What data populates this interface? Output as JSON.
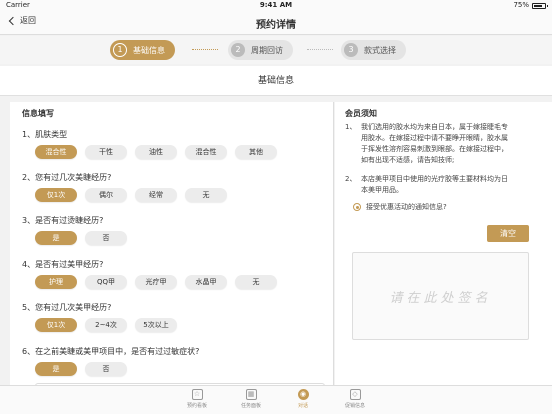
{
  "status": {
    "carrier": "Carrier",
    "time": "9:41 AM",
    "battery": "75%",
    "battery_level": 0.75
  },
  "nav": {
    "back_label": "返回",
    "title": "预约详情"
  },
  "steps": [
    {
      "num": "1",
      "label": "基础信息",
      "state": "active"
    },
    {
      "num": "2",
      "label": "周期回访",
      "state": "idle"
    },
    {
      "num": "3",
      "label": "款式选择",
      "state": "idle"
    }
  ],
  "section_title": "基础信息",
  "form": {
    "heading": "信息填写",
    "questions": [
      {
        "text": "1、肌肤类型",
        "options": [
          "混合性",
          "干性",
          "油性",
          "混合性",
          "其他"
        ],
        "selected": 0
      },
      {
        "text": "2、您有过几次美睫经历?",
        "options": [
          "仅1次",
          "偶尔",
          "经常",
          "无"
        ],
        "selected": 0
      },
      {
        "text": "3、是否有过烫睫经历?",
        "options": [
          "是",
          "否"
        ],
        "selected": 0
      },
      {
        "text": "4、是否有过美甲经历?",
        "options": [
          "护理",
          "QQ甲",
          "光疗甲",
          "水晶甲",
          "无"
        ],
        "selected": 0
      },
      {
        "text": "5、您有过几次美甲经历?",
        "options": [
          "仅1次",
          "2~4次",
          "5次以上"
        ],
        "selected": 0
      },
      {
        "text": "6、在之前美睫或美甲项目中，是否有过过敏症状?",
        "options": [
          "是",
          "否"
        ],
        "selected": 0
      }
    ]
  },
  "notice": {
    "heading": "会员须知",
    "items": [
      {
        "n": "1、",
        "lines": [
          "我们选用的胶水均为来自日本，属于嫁接睫毛专",
          "用胶水。在嫁接过程中请不要睁开眼睛，胶水属",
          "于挥发性溶剂容易刺激到眼部。在嫁接过程中，",
          "如有出现不适感，请告知技师;"
        ]
      },
      {
        "n": "2、",
        "lines": [
          "本店美甲项目中使用的光疗胶等主要材料均为日",
          "本美甲用品。"
        ]
      }
    ],
    "consent_label": "接受优惠活动的通知信息?",
    "clear_label": "清空",
    "signature_placeholder": "请在此处签名"
  },
  "tabbar": [
    {
      "icon": "star-icon",
      "glyph": "☆",
      "label": "预约看板",
      "active": false
    },
    {
      "icon": "grid-icon",
      "glyph": "▦",
      "label": "任务面板",
      "active": false
    },
    {
      "icon": "chat-icon",
      "glyph": "◉",
      "label": "对话",
      "active": true
    },
    {
      "icon": "tag-icon",
      "glyph": "◇",
      "label": "促销信息",
      "active": false
    }
  ],
  "colors": {
    "accent": "#c39a55",
    "chip": "#ececec"
  }
}
